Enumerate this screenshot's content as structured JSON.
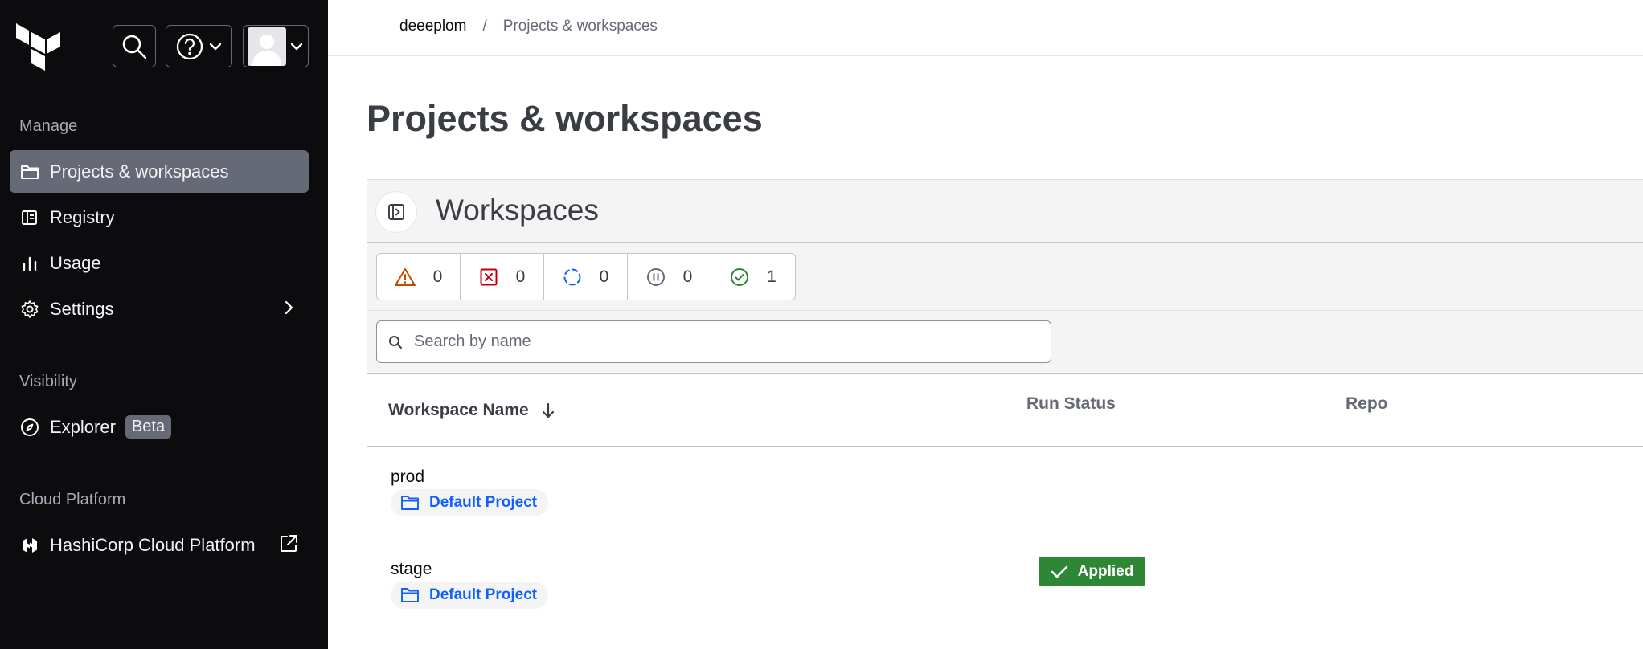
{
  "breadcrumb": {
    "org": "deeeplom",
    "separator": "/",
    "current": "Projects & workspaces"
  },
  "page": {
    "title": "Projects & workspaces"
  },
  "sidebar": {
    "manage_label": "Manage",
    "visibility_label": "Visibility",
    "cloud_label": "Cloud Platform",
    "items": [
      {
        "label": "Projects & workspaces",
        "icon": "folder-icon",
        "active": true
      },
      {
        "label": "Registry",
        "icon": "registry-icon"
      },
      {
        "label": "Usage",
        "icon": "bar-chart-icon"
      },
      {
        "label": "Settings",
        "icon": "gear-icon"
      }
    ],
    "explorer": {
      "label": "Explorer",
      "badge": "Beta",
      "icon": "compass-icon"
    },
    "hcp": {
      "label": "HashiCorp Cloud Platform",
      "icon": "hashicorp-icon"
    }
  },
  "workspaces": {
    "title": "Workspaces",
    "filters": [
      {
        "name": "warning",
        "count": "0",
        "color": "#c04c00"
      },
      {
        "name": "errored",
        "count": "0",
        "color": "#c00005"
      },
      {
        "name": "running",
        "count": "0",
        "color": "#1060ff"
      },
      {
        "name": "paused",
        "count": "0",
        "color": "#656a76"
      },
      {
        "name": "applied",
        "count": "1",
        "color": "#2e8734"
      }
    ],
    "search_placeholder": "Search by name",
    "columns": {
      "name": "Workspace Name",
      "run_status": "Run Status",
      "repo": "Repo"
    },
    "rows": [
      {
        "name": "prod",
        "project": "Default Project",
        "status": ""
      },
      {
        "name": "stage",
        "project": "Default Project",
        "status": "Applied"
      }
    ]
  }
}
